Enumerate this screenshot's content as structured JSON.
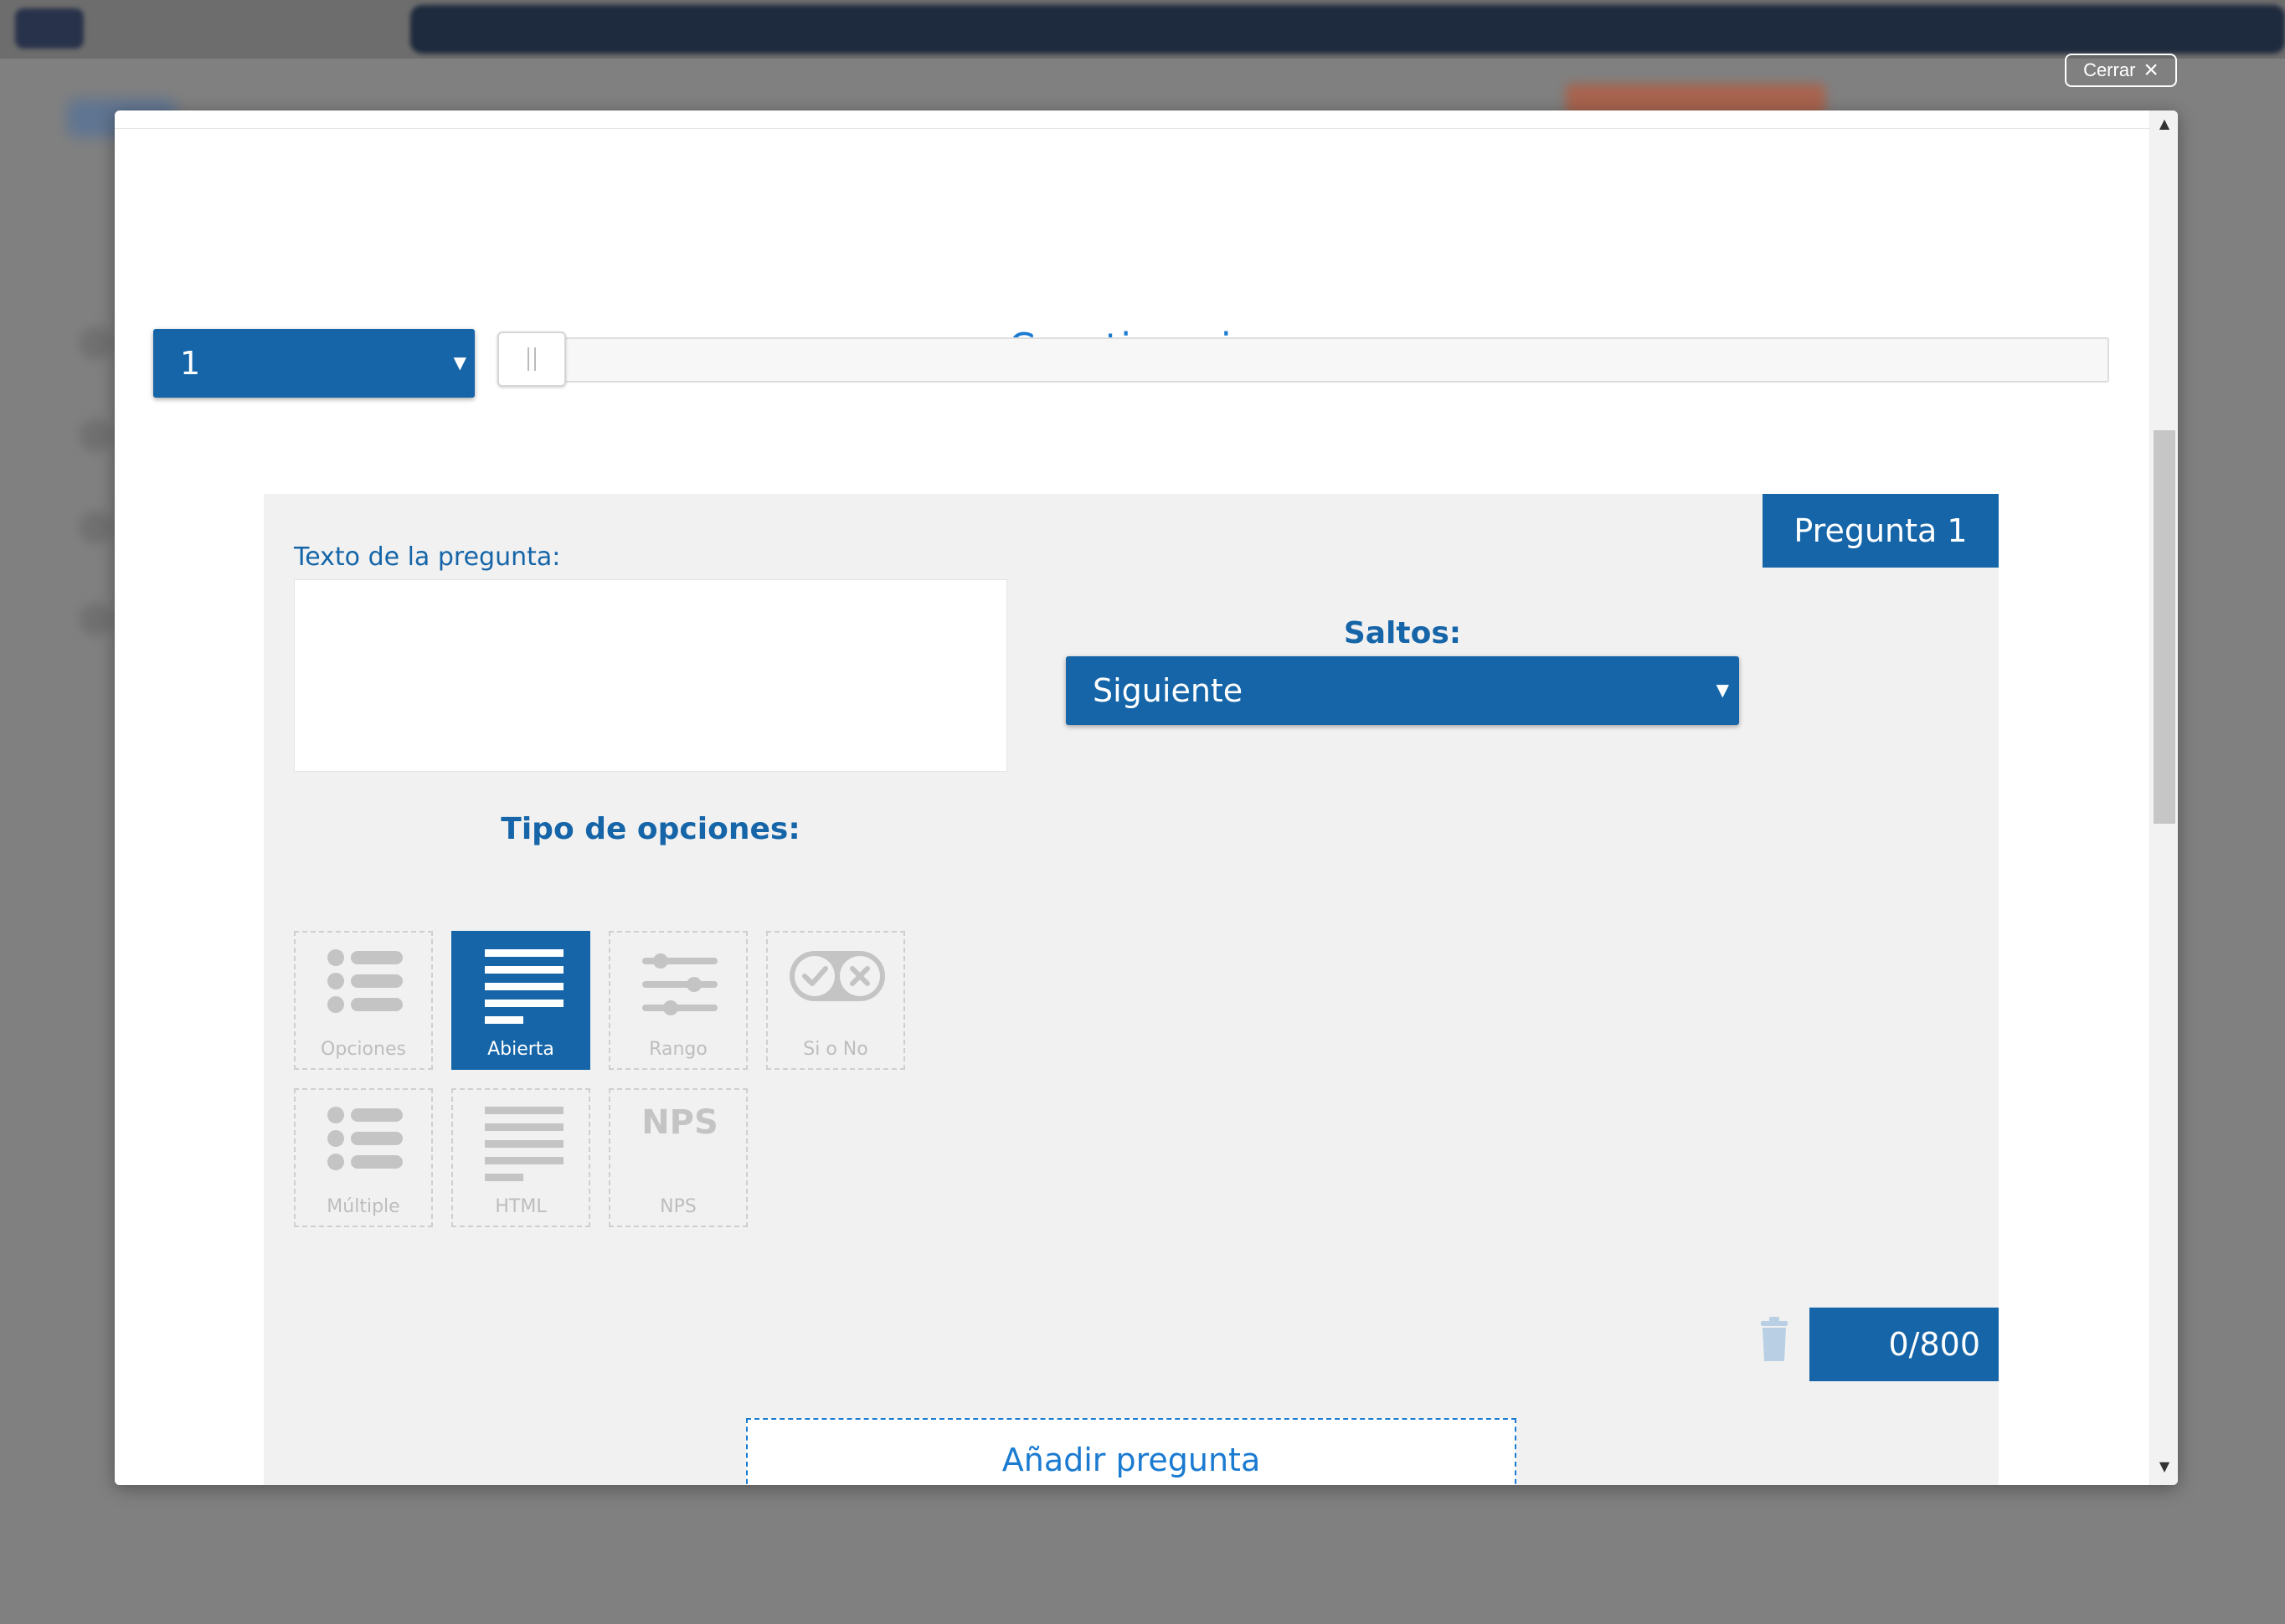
{
  "close": {
    "label": "Cerrar",
    "icon": "close-icon"
  },
  "modal": {
    "title": "Cuestionario",
    "page_select": {
      "value": "1",
      "icon": "caret-down-icon"
    },
    "progress": {
      "value": 0.0
    }
  },
  "question": {
    "tab_label": "Pregunta 1",
    "text_label": "Texto de la pregunta:",
    "text_value": "",
    "jumps_label": "Saltos:",
    "jumps_value": "Siguiente",
    "options_type_label": "Tipo de opciones:",
    "types": [
      {
        "label": "Opciones",
        "icon": "list-icon",
        "selected": false
      },
      {
        "label": "Abierta",
        "icon": "text-lines-icon",
        "selected": true
      },
      {
        "label": "Rango",
        "icon": "sliders-icon",
        "selected": false
      },
      {
        "label": "Si o No",
        "icon": "yes-no-toggle-icon",
        "selected": false
      },
      {
        "label": "Múltiple",
        "icon": "list-icon",
        "selected": false
      },
      {
        "label": "HTML",
        "icon": "text-lines-icon",
        "selected": false
      },
      {
        "label": "NPS",
        "icon": "nps-icon",
        "selected": false
      }
    ],
    "nps_glyph": "NPS",
    "counter": "0/800",
    "delete_icon": "trash-icon"
  },
  "add_question_label": "Añadir pregunta",
  "colors": {
    "primary": "#1565a8",
    "accent": "#1b7bd1",
    "panel_bg": "#f1f1f1",
    "disabled": "#bdbdbd"
  }
}
